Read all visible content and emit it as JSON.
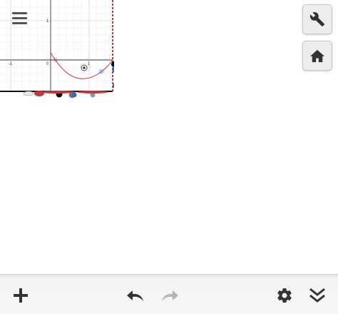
{
  "graph": {
    "tick_labels": {
      "x_neg1": "-1",
      "x_zero": "0",
      "x_one": "1",
      "y_one": "1"
    },
    "colors": {
      "curve": "#c0393b",
      "axis": "#222222",
      "grid": "#e6e6e6",
      "point_dark": "#000000",
      "point_blue": "#2f6fc0",
      "point_red": "#c0393b"
    }
  },
  "icons": {
    "menu": "hamburger-icon",
    "wrench": "wrench-icon",
    "home": "home-icon",
    "add": "plus-icon",
    "undo": "undo-icon",
    "redo": "redo-icon",
    "settings": "gear-icon",
    "collapse": "double-chevron-down-icon"
  },
  "toolbar": {
    "icon_color": "#333333",
    "redo_color": "#b5b5b5"
  }
}
